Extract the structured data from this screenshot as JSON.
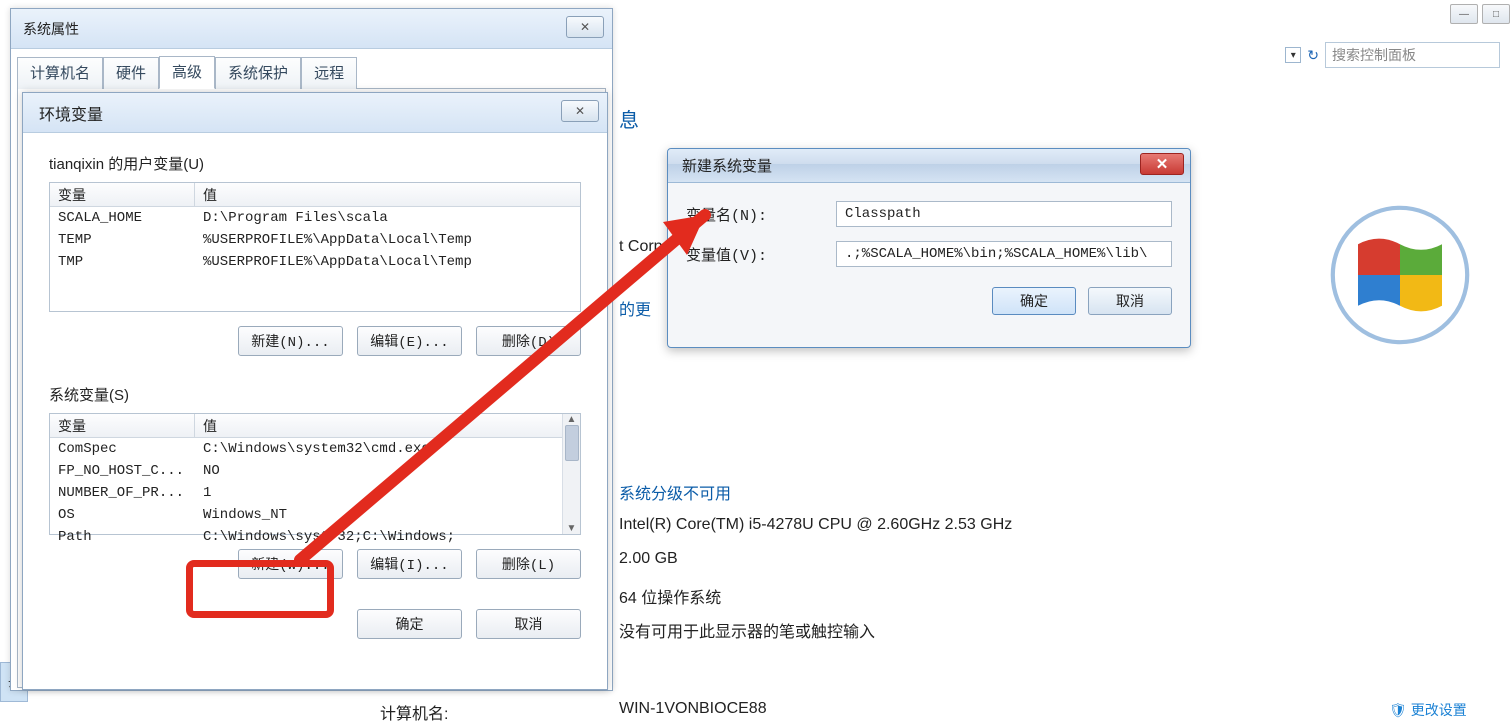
{
  "cp": {
    "info_heading_fragment": "息",
    "search_placeholder": "搜索控制面板",
    "frag_corp": "t Corp",
    "frag_link_update": "的更",
    "rating_label": "系统分级不可用",
    "cpu": "Intel(R) Core(TM) i5-4278U CPU @ 2.60GHz   2.53 GHz",
    "ram": "2.00 GB",
    "os_type": "64 位操作系统",
    "pen_touch": "没有可用于此显示器的笔或触控输入",
    "computer_name_label": "计算机名:",
    "computer_name_value_fragment": "WIN-1VONBIOCE88",
    "change_settings": "更改设置"
  },
  "sysprops": {
    "title": "系统属性",
    "tabs": [
      "计算机名",
      "硬件",
      "高级",
      "系统保护",
      "远程"
    ]
  },
  "env": {
    "title": "环境变量",
    "user_label": "tianqixin 的用户变量(U)",
    "sys_label": "系统变量(S)",
    "col_name": "变量",
    "col_val": "值",
    "user_vars": [
      {
        "name": "SCALA_HOME",
        "value": "D:\\Program Files\\scala"
      },
      {
        "name": "TEMP",
        "value": "%USERPROFILE%\\AppData\\Local\\Temp"
      },
      {
        "name": "TMP",
        "value": "%USERPROFILE%\\AppData\\Local\\Temp"
      }
    ],
    "sys_vars": [
      {
        "name": "ComSpec",
        "value": "C:\\Windows\\system32\\cmd.exe"
      },
      {
        "name": "FP_NO_HOST_C...",
        "value": "NO"
      },
      {
        "name": "NUMBER_OF_PR...",
        "value": "1"
      },
      {
        "name": "OS",
        "value": "Windows_NT"
      },
      {
        "name": "Path",
        "value": "C:\\Windows\\syst   32;C:\\Windows;"
      }
    ],
    "user_new": "新建(N)...",
    "user_edit": "编辑(E)...",
    "user_del": "删除(D)",
    "sys_new": "新建(W)...",
    "sys_edit": "编辑(I)...",
    "sys_del": "删除(L)",
    "ok": "确定",
    "cancel": "取消"
  },
  "newvar": {
    "title": "新建系统变量",
    "name_label": "变量名(N):",
    "value_label": "变量值(V):",
    "name_value": "Classpath",
    "value_value": ".;%SCALA_HOME%\\bin;%SCALA_HOME%\\lib\\",
    "ok": "确定",
    "cancel": "取消"
  }
}
